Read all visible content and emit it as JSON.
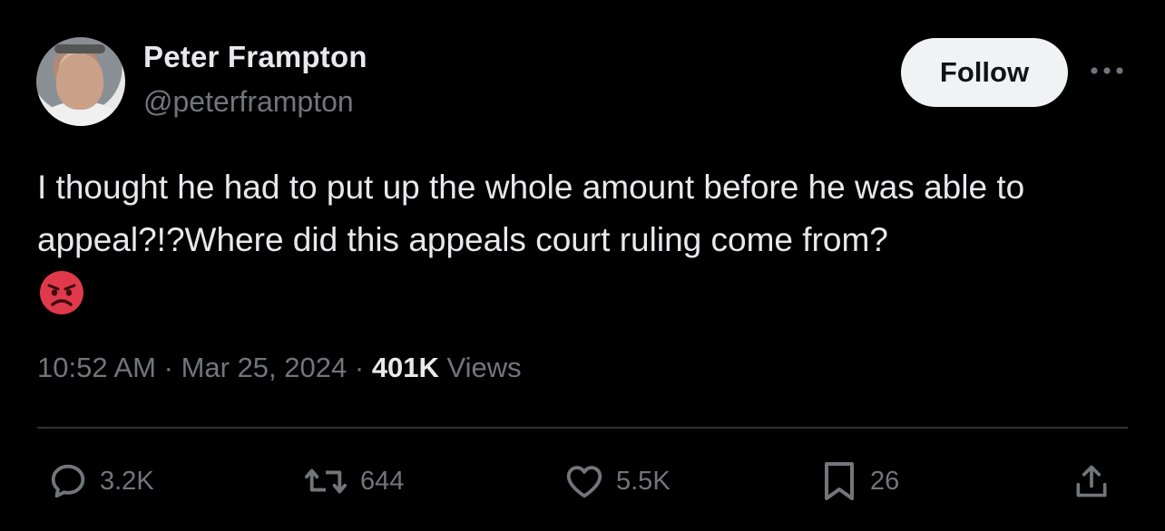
{
  "author": {
    "name": "Peter Frampton",
    "handle": "@peterframpton"
  },
  "follow_label": "Follow",
  "more_icon": "more-horizontal-icon",
  "tweet": {
    "text": "I thought he had to put up the whole amount before he was able to appeal?!?Where did this appeals court ruling come from?",
    "emoji": "angry-face-emoji"
  },
  "meta": {
    "time": "10:52 AM",
    "separator": "·",
    "date": "Mar 25, 2024",
    "views_count": "401K",
    "views_label": "Views"
  },
  "actions": {
    "replies": "3.2K",
    "reposts": "644",
    "likes": "5.5K",
    "bookmarks": "26"
  },
  "colors": {
    "background": "#000000",
    "text": "#e7e9ea",
    "secondary": "#71767b",
    "divider": "#2f3336",
    "follow_bg": "#eff3f4",
    "emoji": "#e0394b"
  }
}
